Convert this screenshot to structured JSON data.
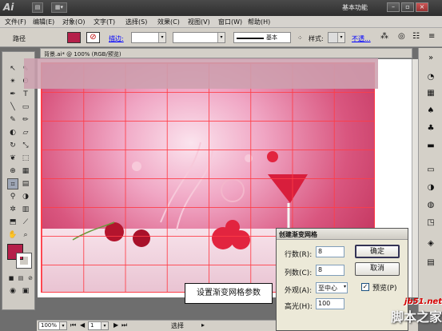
{
  "app": {
    "logo": "Ai",
    "workspace": "基本功能"
  },
  "menu": [
    "文件(F)",
    "编辑(E)",
    "对象(O)",
    "文字(T)",
    "选择(S)",
    "效果(C)",
    "视图(V)",
    "窗口(W)",
    "帮助(H)"
  ],
  "control": {
    "label": "路径",
    "stroke_label": "描边:",
    "style_label": "基本",
    "style2_label": "样式:",
    "opacity_label": "不透..."
  },
  "document": {
    "tab": "背景.ai* @ 100% (RGB/预览)"
  },
  "caption": "设置渐变网格参数",
  "dialog": {
    "title": "创建渐变网格",
    "rows_label": "行数(R):",
    "rows": "8",
    "cols_label": "列数(C):",
    "cols": "8",
    "appearance_label": "外观(A):",
    "appearance": "至中心",
    "highlight_label": "高光(H):",
    "highlight": "100",
    "ok": "确定",
    "cancel": "取消",
    "preview_label": "预览(P)"
  },
  "status": {
    "zoom": "100%",
    "page": "1",
    "mode": "选择"
  },
  "watermark": {
    "site": "jb51.net",
    "name": "脚本之家"
  },
  "colors": {
    "fill": "#b5204a",
    "accent": "#d40000"
  }
}
